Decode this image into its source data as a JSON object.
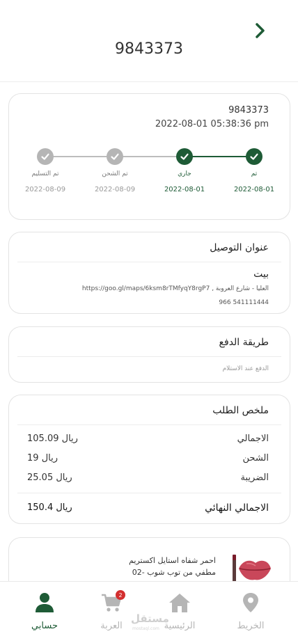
{
  "header": {
    "title": "9843373"
  },
  "status_card": {
    "order_number": "9843373",
    "order_datetime": "2022-08-01 05:38:36 pm",
    "steps": [
      {
        "label": "تم",
        "date": "2022-08-01",
        "state": "done"
      },
      {
        "label": "جاري",
        "date": "2022-08-01",
        "state": "done"
      },
      {
        "label": "تم الشحن",
        "date": "2022-08-09",
        "state": "pending"
      },
      {
        "label": "تم التسليم",
        "date": "2022-08-09",
        "state": "pending"
      }
    ]
  },
  "address": {
    "title": "عنوان التوصيل",
    "name": "بيت",
    "line": "العليا - شارع العروبة , https://goo.gl/maps/6ksm8rTMfyqY8rgP7",
    "phone": "966 541111444"
  },
  "payment": {
    "title": "طريقة الدفع",
    "method": "الدفع عند الاستلام"
  },
  "summary": {
    "title": "ملخص الطلب",
    "rows": [
      {
        "label": "الاجمالي",
        "value": "105.09 ريال"
      },
      {
        "label": "الشحن",
        "value": "19 ريال"
      },
      {
        "label": "الضريبة",
        "value": "25.05 ريال"
      }
    ],
    "total_label": "الاجمالي النهائي",
    "total_value": "150.4 ريال"
  },
  "product": {
    "name_line1": "احمر شفاه استايل اكستريم",
    "name_line2": "مطفي من توب شوب -02"
  },
  "nav": {
    "items": [
      {
        "label": "حسابي",
        "icon": "person-icon",
        "active": true
      },
      {
        "label": "العربة",
        "icon": "cart-icon",
        "badge": "2"
      },
      {
        "label": "الرئيسية",
        "icon": "home-icon"
      },
      {
        "label": "الخريط",
        "icon": "map-pin-icon"
      }
    ],
    "watermark": "مستقل",
    "watermark_sub": "mostaql.com"
  },
  "colors": {
    "primary": "#1e5b36",
    "inactive": "#b5b5b5",
    "badge": "#d32f2f"
  }
}
